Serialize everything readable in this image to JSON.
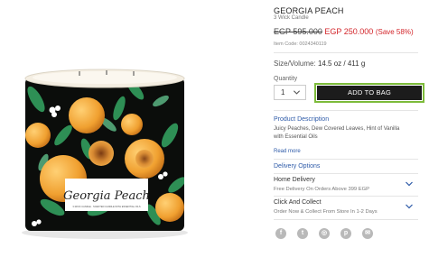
{
  "product": {
    "title": "GEORGIA PEACH",
    "subtitle": "3 Wick Candle",
    "price_old": "EGP 595.000",
    "price_new": "EGP 250.000",
    "price_save": "(Save 58%)",
    "item_code": "Item Code: 0024340119",
    "size_label": "Size/Volume:",
    "size_value": "14.5 oz / 411 g",
    "qty_label": "Quantity",
    "qty_value": "1",
    "add_to_bag": "ADD TO BAG",
    "label_brand": "Georgia Peach",
    "label_fine": "3-WICK CANDLE · SCENTED CANDLE WITH ESSENTIAL OILS"
  },
  "description": {
    "title": "Product Description",
    "text": "Juicy Peaches, Dew Covered Leaves, Hint of Vanilla with Essential Oils",
    "read_more": "Read more"
  },
  "delivery": {
    "title": "Delivery Options",
    "options": [
      {
        "title": "Home Delivery",
        "sub": "Free Delivery On Orders Above 399 EGP"
      },
      {
        "title": "Click And Collect",
        "sub": "Order Now & Collect From Store In 1-2 Days"
      }
    ]
  },
  "social": [
    {
      "icon": "facebook-icon",
      "glyph": "f"
    },
    {
      "icon": "twitter-icon",
      "glyph": "t"
    },
    {
      "icon": "instagram-icon",
      "glyph": "◎"
    },
    {
      "icon": "pinterest-icon",
      "glyph": "p"
    },
    {
      "icon": "email-icon",
      "glyph": "✉"
    }
  ],
  "colors": {
    "accent": "#2d5aa8",
    "sale": "#d3262b",
    "focus": "#7dbb3a"
  }
}
